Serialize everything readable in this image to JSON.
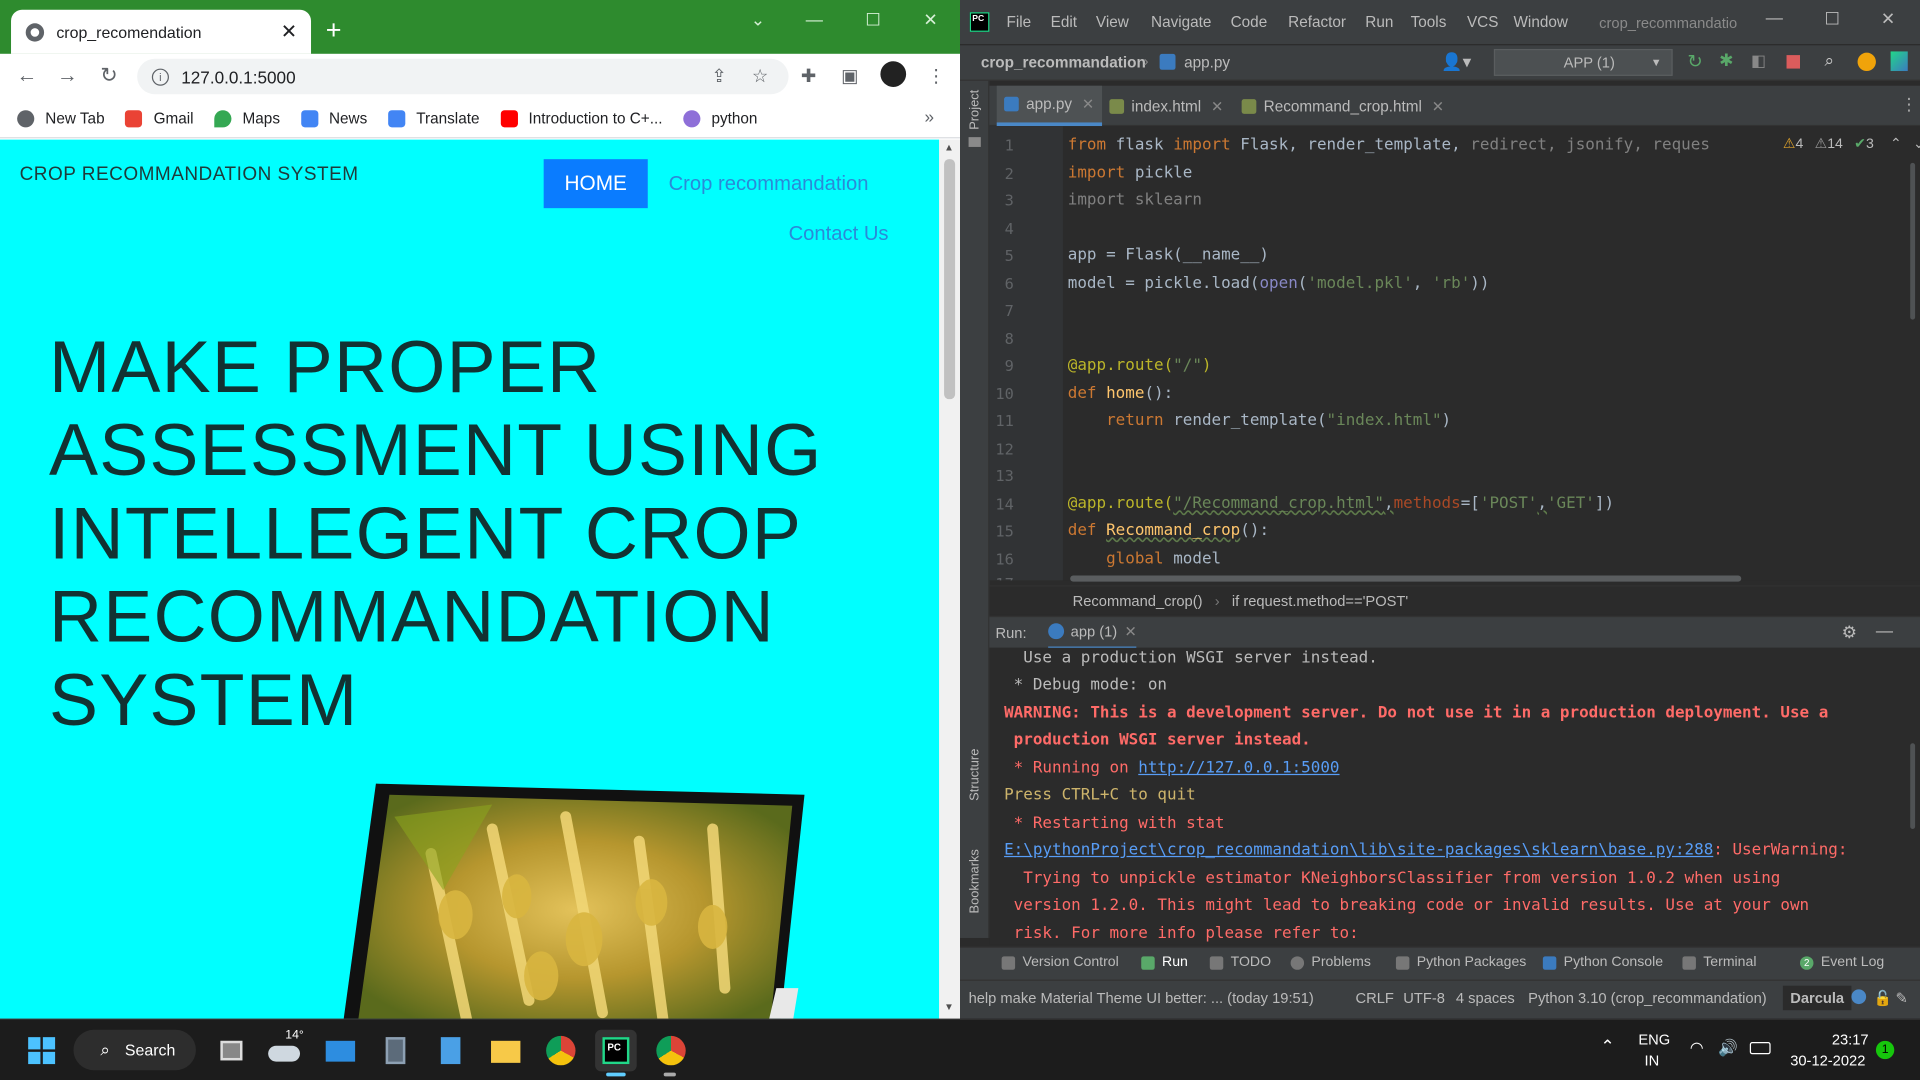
{
  "browser": {
    "tab_title": "crop_recomendation",
    "new_tab_label": "+",
    "url": "127.0.0.1:5000",
    "bookmarks": [
      {
        "label": "New Tab",
        "color": "#5f6368"
      },
      {
        "label": "Gmail",
        "color": "#ea4335"
      },
      {
        "label": "Maps",
        "color": "#34a853"
      },
      {
        "label": "News",
        "color": "#4285f4"
      },
      {
        "label": "Translate",
        "color": "#4285f4"
      },
      {
        "label": "Introduction to C+...",
        "color": "#ff0000"
      },
      {
        "label": "python",
        "color": "#8e6fd8"
      }
    ],
    "bookmarks_more": "»"
  },
  "site": {
    "brand": "CROP RECOMMANDATION SYSTEM",
    "nav_home": "HOME",
    "nav_crop": "Crop recommandation",
    "nav_contact": "Contact Us",
    "hero_lines": [
      "MAKE PROPER",
      "ASSESSMENT USING",
      "INTELLEGENT CROP",
      "RECOMMANDATION",
      "SYSTEM"
    ]
  },
  "ide": {
    "menu": [
      "File",
      "Edit",
      "View",
      "Navigate",
      "Code",
      "Refactor",
      "Run",
      "Tools",
      "VCS",
      "Window"
    ],
    "window_title": "crop_recommandatio",
    "project": "crop_recommandation",
    "current_file": "app.py",
    "run_config": "APP (1)",
    "tabs": [
      "app.py",
      "index.html",
      "Recommand_crop.html"
    ],
    "inspections": {
      "warnings": "4",
      "weak": "14",
      "ok": "3"
    },
    "line_numbers": [
      "1",
      "2",
      "3",
      "4",
      "5",
      "6",
      "7",
      "8",
      "9",
      "10",
      "11",
      "12",
      "13",
      "14",
      "15",
      "16",
      "17"
    ],
    "code": {
      "l1": [
        "from",
        " flask ",
        "import",
        " Flask, render_template, ",
        "redirect, jsonify, reques"
      ],
      "l2": [
        "import",
        " pickle"
      ],
      "l3": [
        "import sklearn"
      ],
      "l5": [
        "app = Flask(__name__)"
      ],
      "l6": [
        "model = pickle.load(",
        "open",
        "(",
        "'model.pkl'",
        ", ",
        "'rb'",
        "))"
      ],
      "l9": [
        "@app.route(",
        "\"/\"",
        ")"
      ],
      "l10": [
        "def",
        " ",
        "home",
        "():"
      ],
      "l11": [
        "    ",
        "return",
        " render_template(",
        "\"index.html\"",
        ")"
      ],
      "l14": [
        "@app.route(",
        "\"/Recommand_crop.html\"",
        ",",
        "methods",
        "=[",
        "'POST'",
        ",",
        "'GET'",
        "])"
      ],
      "l15": [
        "def",
        " ",
        "Recommand_crop",
        "():"
      ],
      "l16": [
        "    ",
        "global",
        " model"
      ],
      "l17": [
        "        "
      ]
    },
    "breadcrumb": [
      "Recommand_crop()",
      "if request.method=='POST'"
    ],
    "run_label": "Run:",
    "run_tab": "app (1)",
    "console": [
      {
        "text": "  Use a production WSGI server instead.",
        "cls": "wht"
      },
      {
        "text": " * Debug mode: on",
        "cls": "wht"
      },
      {
        "text": "WARNING: This is a development server. Do not use it in a production deployment. Use a",
        "cls": "red"
      },
      {
        "text": " production WSGI server instead.",
        "cls": "red"
      },
      {
        "text": " * Running on ",
        "cls": "red",
        "link": "http://127.0.0.1:5000"
      },
      {
        "text": "Press CTRL+C to quit",
        "cls": "ylw"
      },
      {
        "text": " * Restarting with stat",
        "cls": "red"
      },
      {
        "text": "",
        "cls": "red",
        "link": "E:\\pythonProject\\crop_recommandation\\lib\\site-packages\\sklearn\\base.py:288",
        "after": ": UserWarning:"
      },
      {
        "text": "  Trying to unpickle estimator KNeighborsClassifier from version 1.0.2 when using",
        "cls": "red"
      },
      {
        "text": " version 1.2.0. This might lead to breaking code or invalid results. Use at your own",
        "cls": "red"
      },
      {
        "text": " risk. For more info please refer to:",
        "cls": "red"
      }
    ],
    "tool_windows": [
      "Version Control",
      "Run",
      "TODO",
      "Problems",
      "Python Packages",
      "Python Console",
      "Terminal",
      "Event Log"
    ],
    "event_count": "2",
    "side_labels": [
      "Project",
      "Structure",
      "Bookmarks"
    ],
    "status": {
      "message": "help make Material Theme UI better: ... (today 19:51)",
      "line_sep": "CRLF",
      "encoding": "UTF-8",
      "indent": "4 spaces",
      "interpreter": "Python 3.10 (crop_recommandation)",
      "theme": "Darcula"
    }
  },
  "taskbar": {
    "search": "Search",
    "weather": "14°",
    "lang1": "ENG",
    "lang2": "IN",
    "time": "23:17",
    "date": "30-12-2022",
    "notif": "1"
  }
}
